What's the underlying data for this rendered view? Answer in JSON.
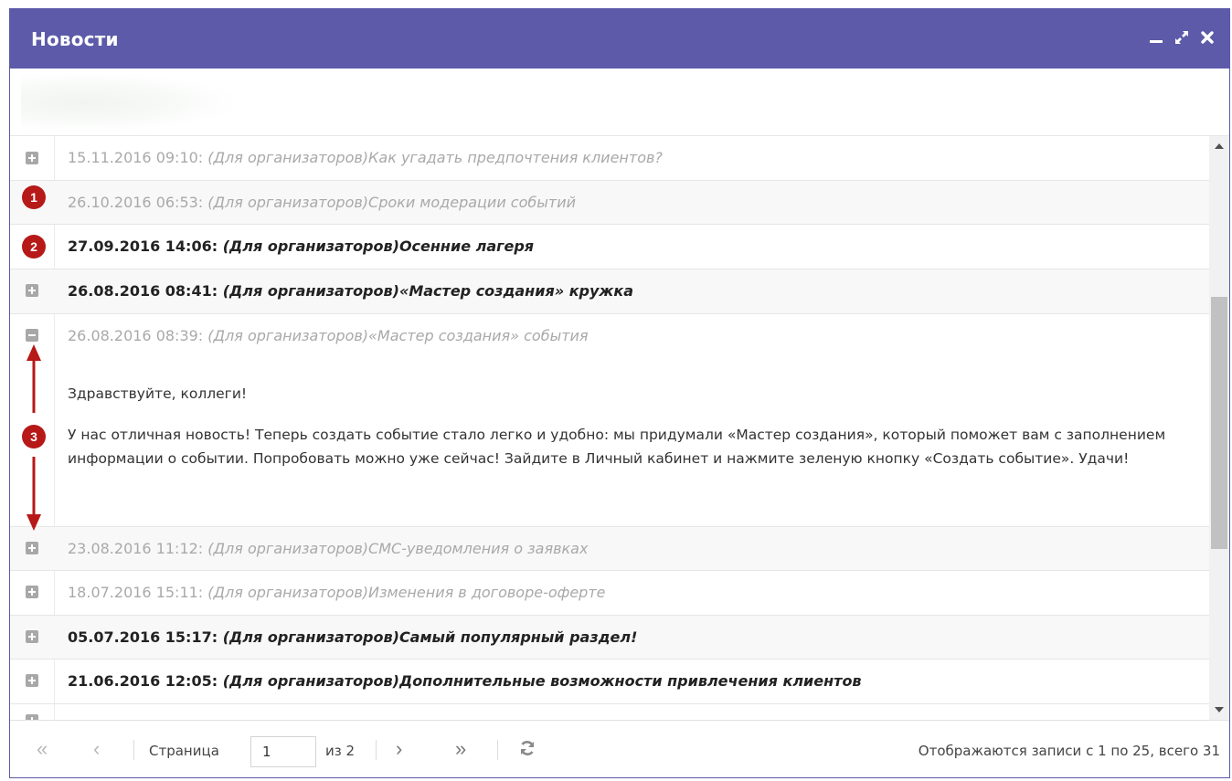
{
  "window": {
    "title": "Новости",
    "controls": [
      "minimize-icon",
      "maximize-icon",
      "close-icon"
    ]
  },
  "news": [
    {
      "datetime": "15.11.2016 09:10:",
      "title": "(Для организаторов)Как угадать предпочтения клиентов?",
      "read": true,
      "expanded": false
    },
    {
      "datetime": "26.10.2016 06:53:",
      "title": "(Для организаторов)Сроки модерации событий",
      "read": true,
      "expanded": false,
      "badge": "1"
    },
    {
      "datetime": "27.09.2016 14:06:",
      "title": "(Для организаторов)Осенние лагеря",
      "read": false,
      "expanded": false,
      "badge": "2"
    },
    {
      "datetime": "26.08.2016 08:41:",
      "title": "(Для организаторов)«Мастер создания» кружка",
      "read": false,
      "expanded": false
    },
    {
      "datetime": "26.08.2016 08:39:",
      "title": "(Для организаторов)«Мастер создания» события",
      "read": true,
      "expanded": true,
      "body": [
        "Здравствуйте, коллеги!",
        "У нас отличная новость! Теперь создать событие стало легко и удобно: мы придумали «Мастер создания», который поможет вам с заполнением информации о событии. Попробовать можно уже сейчас! Зайдите в Личный кабинет и нажмите зеленую кнопку «Создать событие». Удачи!"
      ]
    },
    {
      "datetime": "23.08.2016 11:12:",
      "title": "(Для организаторов)СМС-уведомления о заявках",
      "read": true,
      "expanded": false
    },
    {
      "datetime": "18.07.2016 15:11:",
      "title": "(Для организаторов)Изменения в договоре-оферте",
      "read": true,
      "expanded": false
    },
    {
      "datetime": "05.07.2016 15:17:",
      "title": "(Для организаторов)Самый популярный раздел!",
      "read": false,
      "expanded": false
    },
    {
      "datetime": "21.06.2016 12:05:",
      "title": "(Для организаторов)Дополнительные возможности привлечения клиентов",
      "read": false,
      "expanded": false
    }
  ],
  "annotation": {
    "badge": "3"
  },
  "pager": {
    "first": "«",
    "prev": "‹",
    "page_label": "Страница",
    "page_value": "1",
    "of_label": "из 2",
    "next": "›",
    "last": "»",
    "refresh_icon": "refresh-icon",
    "status": "Отображаются записи с 1 по 25, всего 31"
  },
  "colors": {
    "header": "#5c5aa9",
    "badge": "#b71818"
  }
}
